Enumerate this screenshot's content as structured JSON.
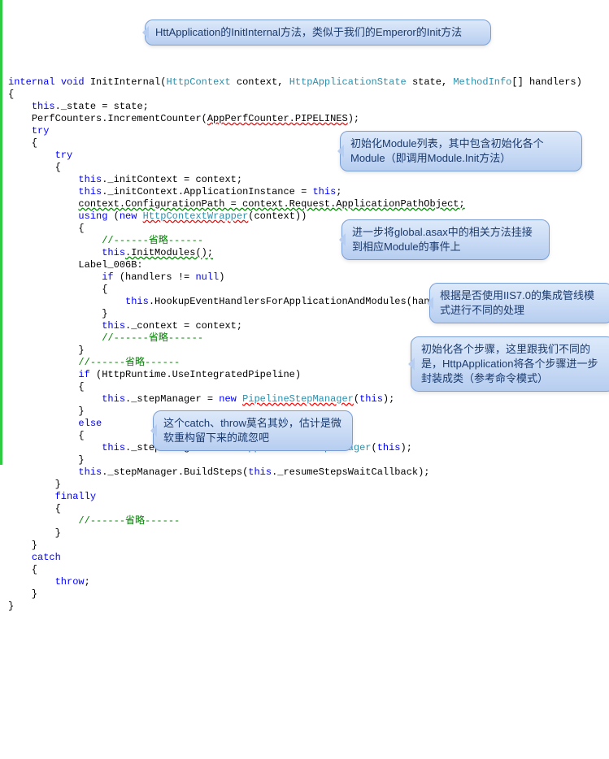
{
  "code": {
    "kw_internal": "internal",
    "kw_void": "void",
    "method_name": "InitInternal",
    "param1_type": "HttpContext",
    "param1_name": "context",
    "param2_type": "HttpApplicationState",
    "param2_name": "state",
    "param3_type": "MethodInfo",
    "param3_name": "handlers",
    "kw_this": "this",
    "state_assign": "._state = state;",
    "perf_line": "PerfCounters.IncrementCounter(",
    "perf_arg": "AppPerfCounter.PIPELINES",
    "perf_end": ");",
    "kw_try": "try",
    "initContext_assign": "._initContext = context;",
    "appInstance_assign": "._initContext.ApplicationInstance = ",
    "appInstance_end": ";",
    "configPath_line": "context.ConfigurationPath = context.Request.ApplicationPathObject;",
    "kw_using": "using",
    "kw_new": "new",
    "wrapper_type": "HttpContextWrapper",
    "wrapper_args": "(context))",
    "comment_omit": "//------省略------",
    "initModules": ".InitModules();",
    "label": "Label_006B:",
    "kw_if": "if",
    "if_handlers_cond": " (handlers != ",
    "kw_null": "null",
    "cond_close": ")",
    "hookup_line": ".HookupEventHandlersForApplicationAndModules(handlers);",
    "context_assign": "._context = context;",
    "integratedPipeline_cond": " (HttpRuntime.UseIntegratedPipeline)",
    "stepManager_assign": "._stepManager = ",
    "pipelineStepMgr": "PipelineStepManager",
    "pipelineStepMgr_args": "(",
    "pipelineStepMgr_end": ");",
    "kw_else": "else",
    "appStepMgr": "ApplicationStepManager",
    "buildSteps_line": "._stepManager.BuildSteps(",
    "buildSteps_arg": "._resumeStepsWaitCallback);",
    "kw_finally": "finally",
    "kw_catch": "catch",
    "kw_throw": "throw",
    "semicolon": ";"
  },
  "callouts": {
    "c1": "HttApplication的InitInternal方法，类似于我们的Emperor的Init方法",
    "c2": "初始化Module列表，其中包含初始化各个Module（即调用Module.Init方法）",
    "c3": "进一步将global.asax中的相关方法挂接到相应Module的事件上",
    "c4": "根据是否使用IIS7.0的集成管线模式进行不同的处理",
    "c5": "初始化各个步骤，这里跟我们不同的是，HttpApplication将各个步骤进一步封装成类（参考命令模式）",
    "c6": "这个catch、throw莫名其妙，估计是微软重构留下来的疏忽吧"
  }
}
